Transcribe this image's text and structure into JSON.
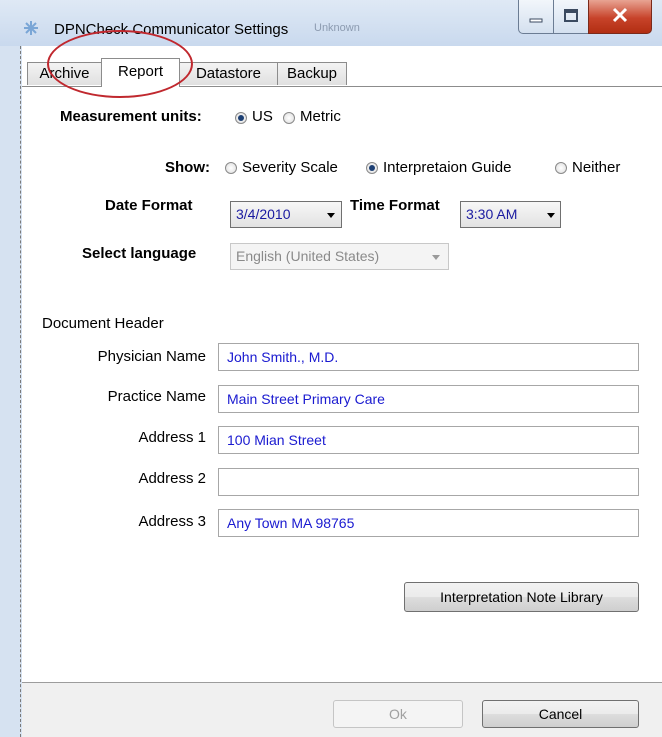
{
  "window": {
    "title": "DPNCheck Communicator Settings",
    "ghost_title": "Unknown"
  },
  "tabs": [
    {
      "label": "Archive",
      "active": false
    },
    {
      "label": "Report",
      "active": true
    },
    {
      "label": "Datastore",
      "active": false
    },
    {
      "label": "Backup",
      "active": false
    }
  ],
  "measurement": {
    "label": "Measurement units:",
    "options": [
      "US",
      "Metric"
    ],
    "selected": "US"
  },
  "show": {
    "label": "Show:",
    "options": [
      "Severity Scale",
      "Interpretaion Guide",
      "Neither"
    ],
    "selected": "Interpretaion Guide"
  },
  "date_format": {
    "label": "Date Format",
    "value": "3/4/2010"
  },
  "time_format": {
    "label": "Time Format",
    "value": "3:30 AM"
  },
  "language": {
    "label": "Select language",
    "value": "English (United States)"
  },
  "document_header": {
    "label": "Document Header",
    "fields": [
      {
        "label": "Physician Name",
        "value": "John Smith., M.D."
      },
      {
        "label": "Practice Name",
        "value": "Main Street Primary Care"
      },
      {
        "label": "Address 1",
        "value": "100 Mian Street"
      },
      {
        "label": "Address 2",
        "value": ""
      },
      {
        "label": "Address 3",
        "value": "Any Town MA 98765"
      }
    ]
  },
  "buttons": {
    "library": "Interpretation Note Library",
    "ok": "Ok",
    "cancel": "Cancel"
  },
  "colors": {
    "input_text": "#1a1ad0",
    "annotation": "#c0282e",
    "radio_selected": "#1c3f73"
  }
}
